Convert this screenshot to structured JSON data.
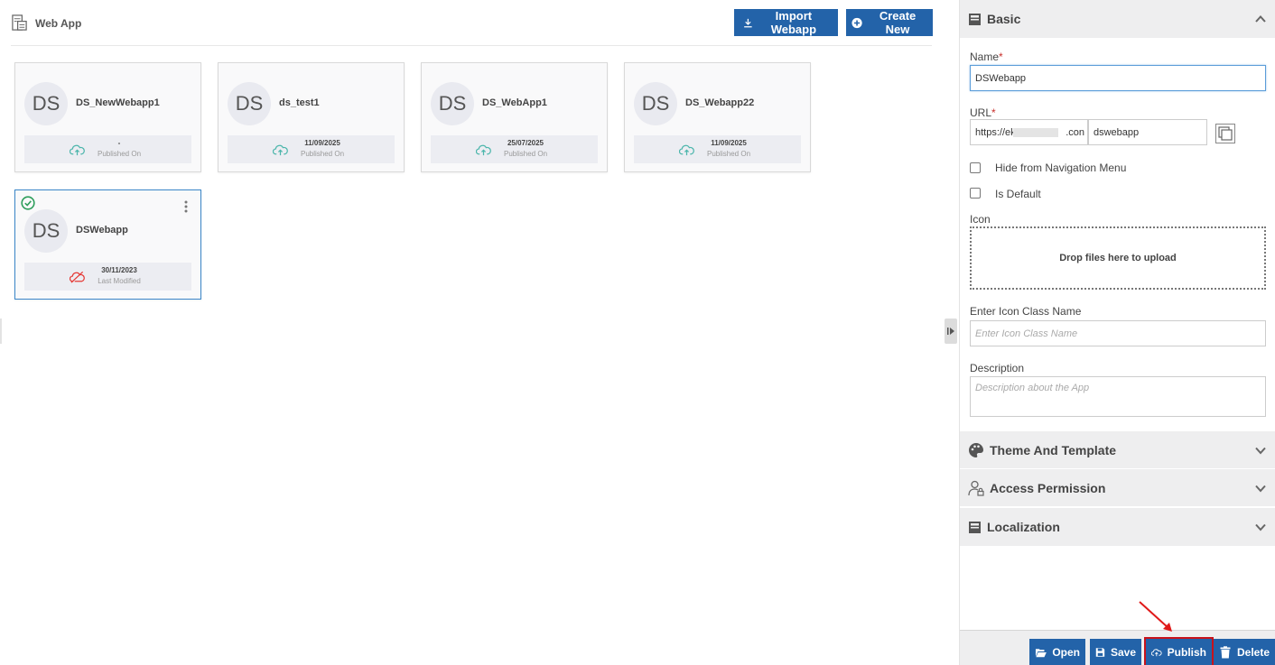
{
  "header": {
    "title": "Web App",
    "import_label": "Import Webapp",
    "create_label": "Create New"
  },
  "cards": [
    {
      "initials": "DS",
      "name": "DS_NewWebapp1",
      "date": "-",
      "status": "Published On"
    },
    {
      "initials": "DS",
      "name": "ds_test1",
      "date": "11/09/2025",
      "status": "Published On"
    },
    {
      "initials": "DS",
      "name": "DS_WebApp1",
      "date": "25/07/2025",
      "status": "Published On"
    },
    {
      "initials": "DS",
      "name": "DS_Webapp22",
      "date": "11/09/2025",
      "status": "Published On"
    },
    {
      "initials": "DS",
      "name": "DSWebapp",
      "date": "30/11/2023",
      "status": "Last Modified"
    }
  ],
  "panel": {
    "basic_title": "Basic",
    "name_label": "Name",
    "name_value": "DSWebapp",
    "url_label": "URL",
    "url_prefix": "https://eks",
    "url_suffix_visible": ".con",
    "url_path": "dswebapp",
    "hide_nav_label": "Hide from Navigation Menu",
    "is_default_label": "Is Default",
    "icon_label": "Icon",
    "dropzone_text": "Drop files here to upload",
    "icon_class_label": "Enter Icon Class Name",
    "icon_class_placeholder": "Enter Icon Class Name",
    "description_label": "Description",
    "description_placeholder": "Description about the App",
    "required_mark": "*",
    "sections": [
      "Theme And Template",
      "Access Permission",
      "Localization"
    ]
  },
  "actions": {
    "open": "Open",
    "save": "Save",
    "publish": "Publish",
    "delete": "Delete"
  },
  "colors": {
    "primary": "#2363a9",
    "published_icon": "#4db6ac",
    "unpublished_icon": "#e53935",
    "selected_check": "#2e9e5b",
    "highlight": "#c8121b"
  }
}
